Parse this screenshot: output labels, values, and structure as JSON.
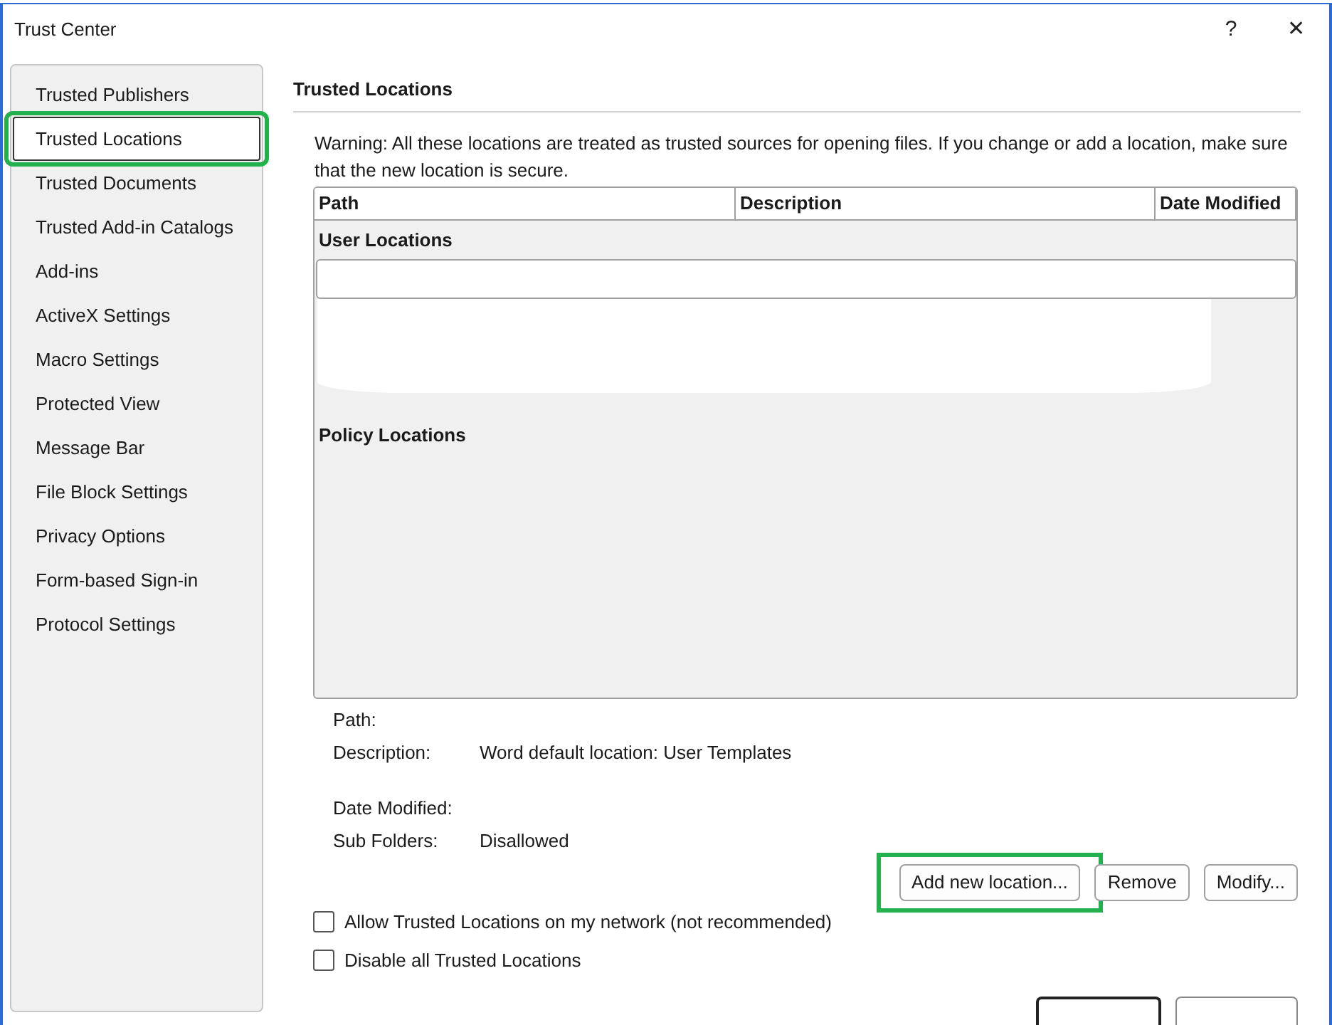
{
  "window": {
    "title": "Trust Center",
    "help": "?",
    "close": "✕"
  },
  "sidebar": {
    "items": [
      {
        "label": "Trusted Publishers",
        "selected": false,
        "highlighted": false
      },
      {
        "label": "Trusted Locations",
        "selected": true,
        "highlighted": true
      },
      {
        "label": "Trusted Documents",
        "selected": false,
        "highlighted": false
      },
      {
        "label": "Trusted Add-in Catalogs",
        "selected": false,
        "highlighted": false
      },
      {
        "label": "Add-ins",
        "selected": false,
        "highlighted": false
      },
      {
        "label": "ActiveX Settings",
        "selected": false,
        "highlighted": false
      },
      {
        "label": "Macro Settings",
        "selected": false,
        "highlighted": false
      },
      {
        "label": "Protected View",
        "selected": false,
        "highlighted": false
      },
      {
        "label": "Message Bar",
        "selected": false,
        "highlighted": false
      },
      {
        "label": "File Block Settings",
        "selected": false,
        "highlighted": false
      },
      {
        "label": "Privacy Options",
        "selected": false,
        "highlighted": false
      },
      {
        "label": "Form-based Sign-in",
        "selected": false,
        "highlighted": false
      },
      {
        "label": "Protocol Settings",
        "selected": false,
        "highlighted": false
      }
    ]
  },
  "section": {
    "heading": "Trusted Locations",
    "warning": "Warning: All these locations are treated as trusted sources for opening files.  If you change or add a location, make sure that the new location is secure."
  },
  "table": {
    "columns": [
      "Path",
      "Description",
      "Date Modified"
    ],
    "groups": [
      {
        "label": "User Locations",
        "has_selected_row": true
      },
      {
        "label": "Policy Locations",
        "has_selected_row": false
      }
    ]
  },
  "details": [
    {
      "label": "Path:"
    },
    {
      "label": "Description:",
      "value": "Word default location: User Templates"
    },
    {
      "label": "Date Modified:"
    },
    {
      "label": "Sub Folders:",
      "value": "Disallowed"
    }
  ],
  "buttons": [
    {
      "label": "Add new location...",
      "highlighted": true
    },
    {
      "label": "Remove",
      "highlighted": false
    },
    {
      "label": "Modify...",
      "highlighted": false
    }
  ],
  "checkboxes": [
    {
      "label": "Allow Trusted Locations on my network (not recommended)",
      "checked": false
    },
    {
      "label": "Disable all Trusted Locations",
      "checked": false
    }
  ]
}
